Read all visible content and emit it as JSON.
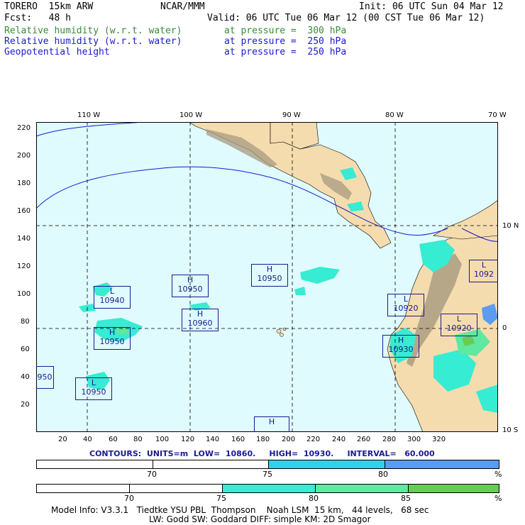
{
  "header": {
    "model": "TORERO  15km ARW",
    "org": "NCAR/MMM",
    "init": "Init: 06 UTC Sun 04 Mar 12",
    "fcst": "Fcst:   48 h",
    "valid": "Valid: 06 UTC Tue 06 Mar 12 (00 CST Tue 06 Mar 12)",
    "fields": [
      {
        "name": "Relative humidity (w.r.t. water)",
        "level": "at pressure =  300 hPa",
        "color": "#3a8a3a"
      },
      {
        "name": "Relative humidity (w.r.t. water)",
        "level": "at pressure =  250 hPa",
        "color": "#1a1ad0"
      },
      {
        "name": "Geopotential height",
        "level": "at pressure =  250 hPa",
        "color": "#1a1ad0"
      }
    ]
  },
  "map": {
    "lon_labels": [
      "110 W",
      "100 W",
      "90 W",
      "80 W",
      "70 W"
    ],
    "lat_labels": [
      "10 N",
      "0",
      "10 S"
    ],
    "y_ticks": [
      "220",
      "200",
      "180",
      "160",
      "140",
      "120",
      "100",
      "80",
      "60",
      "40",
      "20"
    ],
    "x_ticks": [
      "20",
      "40",
      "60",
      "80",
      "100",
      "120",
      "140",
      "160",
      "180",
      "200",
      "220",
      "240",
      "260",
      "280",
      "300",
      "320"
    ],
    "ocean_color": "#dffbfd",
    "land_color": "#f5dcae",
    "highs_lows": [
      {
        "type": "L",
        "value": "10940"
      },
      {
        "type": "H",
        "value": "10950"
      },
      {
        "type": "H",
        "value": "10950"
      },
      {
        "type": "H",
        "value": "10960"
      },
      {
        "type": "H",
        "value": "10950"
      },
      {
        "type": "L",
        "value": "10920"
      },
      {
        "type": "L",
        "value": "10920"
      },
      {
        "type": "H",
        "value": "10930"
      },
      {
        "type": "L",
        "value": "1092"
      },
      {
        "type": "L",
        "value": "10950"
      },
      {
        "type": "",
        "value": "950"
      },
      {
        "type": "H",
        "value": ""
      }
    ]
  },
  "contours_line": "CONTOURS:  UNITS=m  LOW=  10860.     HIGH=  10930.     INTERVAL=   60.000",
  "colorbars": [
    {
      "labels": [
        "70",
        "75",
        "80"
      ],
      "unit": "%",
      "colors": [
        "#ffffff",
        "#ffffff",
        "#2ed3e8",
        "#5a9cf0"
      ]
    },
    {
      "labels": [
        "70",
        "75",
        "80",
        "85"
      ],
      "unit": "%",
      "colors": [
        "#ffffff",
        "#ffffff",
        "#36ecd2",
        "#5ee8a0",
        "#66cc55"
      ]
    }
  ],
  "footer": {
    "line1": "Model Info: V3.3.1   Tiedtke YSU PBL  Thompson    Noah LSM  15 km,   44 levels,   68 sec",
    "line2": "LW: Godd SW: Goddard DIFF: simple KM: 2D Smagor"
  }
}
